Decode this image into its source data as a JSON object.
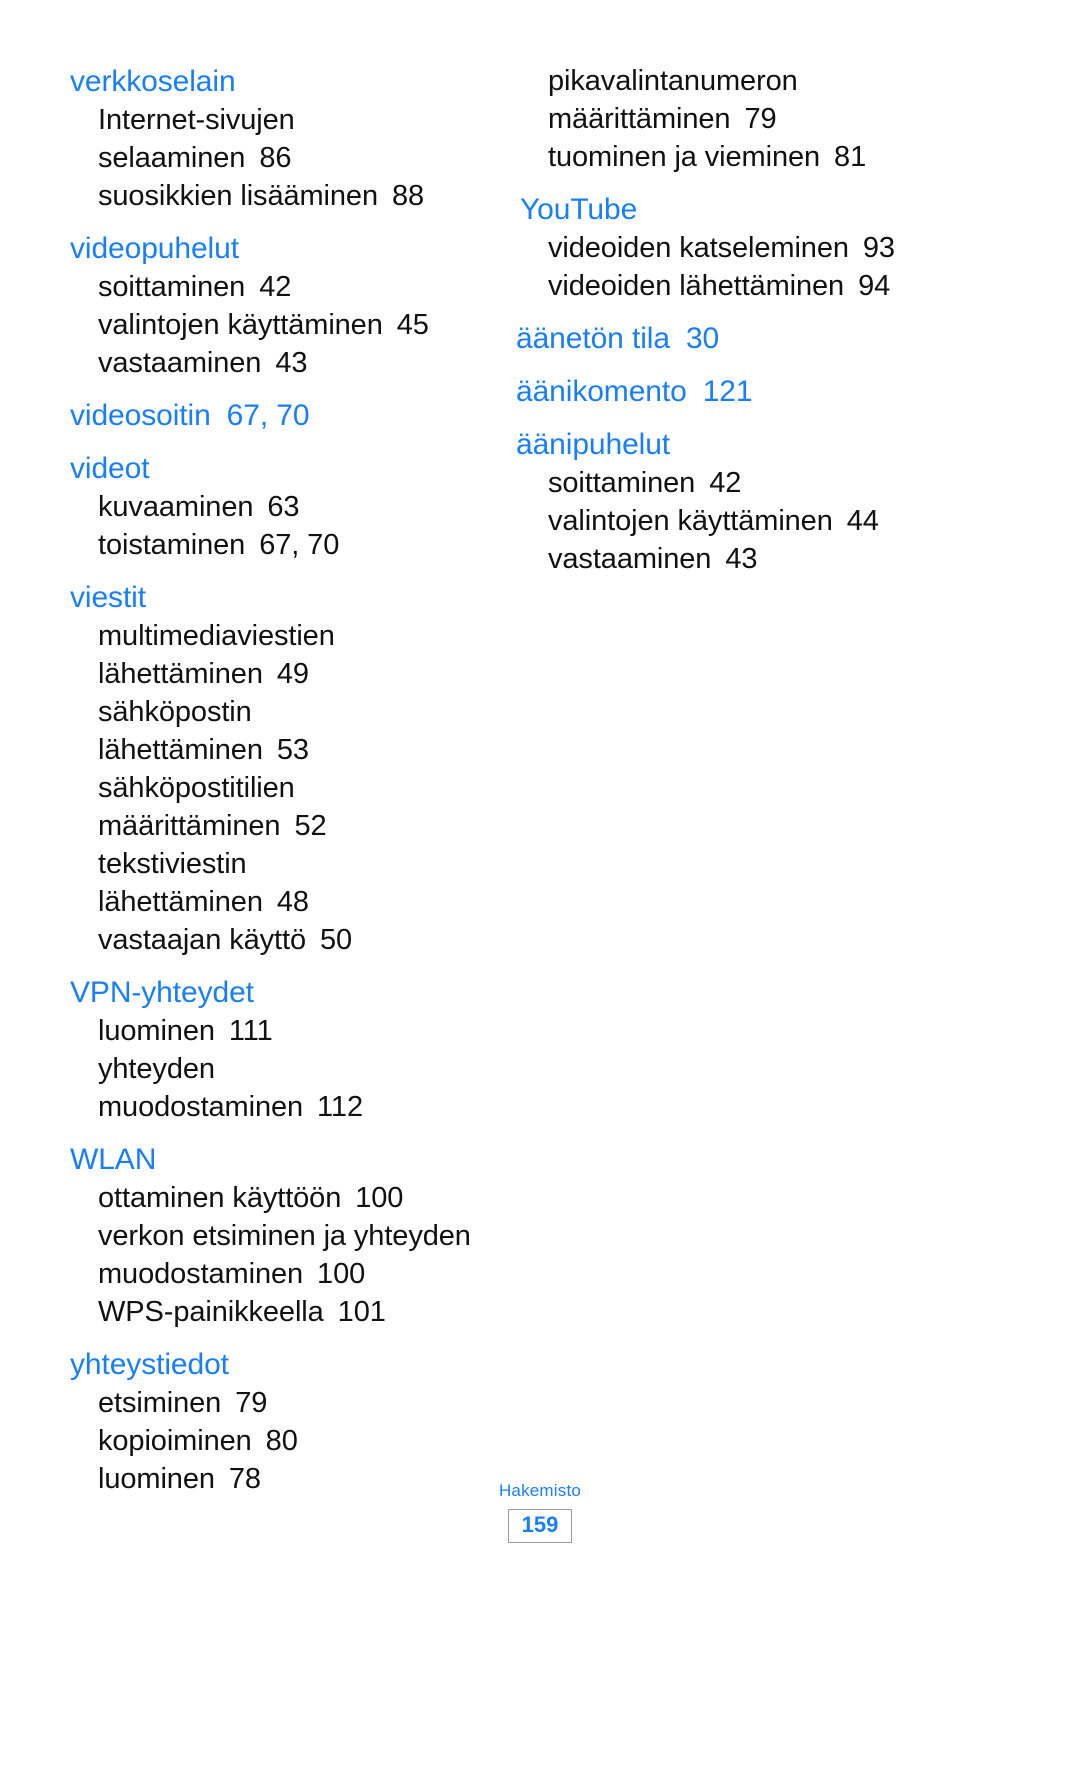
{
  "document": {
    "language": "fi",
    "footer": {
      "section_label": "Hakemisto",
      "page_number": "159"
    },
    "accent_color": "#1a7ef5",
    "text_color": "#111111"
  },
  "columns": {
    "left": [
      {
        "term": "verkkoselain",
        "pages": "",
        "entries": [
          {
            "lines": [
              "Internet-sivujen",
              "selaaminen"
            ],
            "pages": "86"
          },
          {
            "lines": [
              "suosikkien lisääminen"
            ],
            "pages": "88"
          }
        ]
      },
      {
        "term": "videopuhelut",
        "pages": "",
        "entries": [
          {
            "lines": [
              "soittaminen"
            ],
            "pages": "42"
          },
          {
            "lines": [
              "valintojen käyttäminen"
            ],
            "pages": "45"
          },
          {
            "lines": [
              "vastaaminen"
            ],
            "pages": "43"
          }
        ]
      },
      {
        "term": "videosoitin",
        "pages": "67, 70",
        "entries": []
      },
      {
        "term": "videot",
        "pages": "",
        "entries": [
          {
            "lines": [
              "kuvaaminen"
            ],
            "pages": "63"
          },
          {
            "lines": [
              "toistaminen"
            ],
            "pages": "67, 70"
          }
        ]
      },
      {
        "term": "viestit",
        "pages": "",
        "entries": [
          {
            "lines": [
              "multimediaviestien",
              "lähettäminen"
            ],
            "pages": "49"
          },
          {
            "lines": [
              "sähköpostin",
              "lähettäminen"
            ],
            "pages": "53"
          },
          {
            "lines": [
              "sähköpostitilien",
              "määrittäminen"
            ],
            "pages": "52"
          },
          {
            "lines": [
              "tekstiviestin",
              "lähettäminen"
            ],
            "pages": "48"
          },
          {
            "lines": [
              "vastaajan käyttö"
            ],
            "pages": "50"
          }
        ]
      },
      {
        "term": "VPN-yhteydet",
        "pages": "",
        "entries": [
          {
            "lines": [
              "luominen"
            ],
            "pages": "111"
          },
          {
            "lines": [
              "yhteyden",
              "muodostaminen"
            ],
            "pages": "112"
          }
        ]
      },
      {
        "term": "WLAN",
        "pages": "",
        "entries": [
          {
            "lines": [
              "ottaminen käyttöön"
            ],
            "pages": "100"
          },
          {
            "lines": [
              "verkon etsiminen ja yhteyden",
              "muodostaminen"
            ],
            "pages": "100"
          },
          {
            "lines": [
              "WPS-painikkeella"
            ],
            "pages": "101"
          }
        ]
      },
      {
        "term": "yhteystiedot",
        "pages": "",
        "entries": [
          {
            "lines": [
              "etsiminen"
            ],
            "pages": "79"
          },
          {
            "lines": [
              "kopioiminen"
            ],
            "pages": "80"
          },
          {
            "lines": [
              "luominen"
            ],
            "pages": "78"
          }
        ]
      }
    ],
    "right": [
      {
        "term": "",
        "pages": "",
        "entries": [
          {
            "lines": [
              "pikavalintanumeron",
              "määrittäminen"
            ],
            "pages": "79"
          },
          {
            "lines": [
              "tuominen ja vieminen"
            ],
            "pages": "81"
          }
        ]
      },
      {
        "term": "YouTube",
        "pages": "",
        "entries": [
          {
            "lines": [
              "videoiden katseleminen"
            ],
            "pages": "93"
          },
          {
            "lines": [
              "videoiden lähettäminen"
            ],
            "pages": "94"
          }
        ]
      },
      {
        "term": "äänetön tila",
        "pages": "30",
        "optical_left": true,
        "entries": []
      },
      {
        "term": "äänikomento",
        "pages": "121",
        "optical_left": true,
        "entries": []
      },
      {
        "term": "äänipuhelut",
        "pages": "",
        "optical_left": true,
        "entries": [
          {
            "lines": [
              "soittaminen"
            ],
            "pages": "42"
          },
          {
            "lines": [
              "valintojen käyttäminen"
            ],
            "pages": "44"
          },
          {
            "lines": [
              "vastaaminen"
            ],
            "pages": "43"
          }
        ]
      }
    ]
  }
}
